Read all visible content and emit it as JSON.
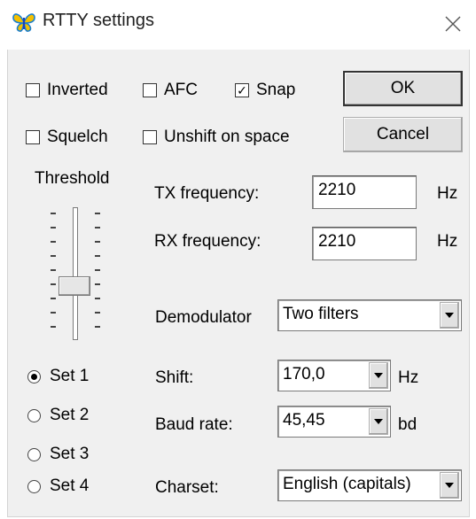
{
  "window": {
    "title": "RTTY settings",
    "app_icon": "butterfly-icon",
    "close_icon": "close-icon"
  },
  "checkboxes": {
    "inverted": {
      "label": "Inverted",
      "checked": false
    },
    "afc": {
      "label": "AFC",
      "checked": false
    },
    "snap": {
      "label": "Snap",
      "checked": true
    },
    "squelch": {
      "label": "Squelch",
      "checked": false
    },
    "unshift": {
      "label": "Unshift on space",
      "checked": false
    }
  },
  "buttons": {
    "ok": "OK",
    "cancel": "Cancel"
  },
  "threshold": {
    "label": "Threshold"
  },
  "tx": {
    "label": "TX frequency:",
    "value": "2210",
    "unit": "Hz"
  },
  "rx": {
    "label": "RX frequency:",
    "value": "2210",
    "unit": "Hz"
  },
  "demodulator": {
    "label": "Demodulator",
    "value": "Two filters"
  },
  "sets": [
    {
      "label": "Set 1",
      "selected": true
    },
    {
      "label": "Set 2",
      "selected": false
    },
    {
      "label": "Set 3",
      "selected": false
    },
    {
      "label": "Set 4",
      "selected": false
    }
  ],
  "shift": {
    "label": "Shift:",
    "value": "170,0",
    "unit": "Hz"
  },
  "baud": {
    "label": "Baud rate:",
    "value": "45,45",
    "unit": "bd"
  },
  "charset": {
    "label": "Charset:",
    "value": "English (capitals)"
  },
  "colors": {
    "dialog_bg": "#f0f0f0",
    "button_face": "#e1e1e1",
    "field_bg": "#ffffff"
  }
}
